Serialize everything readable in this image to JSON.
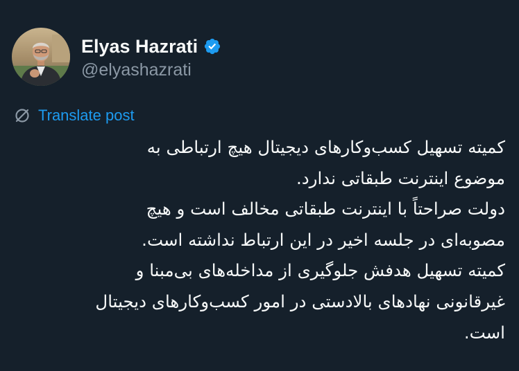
{
  "author": {
    "display_name": "Elyas Hazrati",
    "handle": "@elyashazrati",
    "verified": true
  },
  "icons": {
    "avatar": "profile-photo",
    "verified": "verified-badge-icon",
    "translate": "translate-icon"
  },
  "colors": {
    "background": "#15202b",
    "text": "#f7f9f9",
    "secondary": "#8b98a5",
    "accent": "#1d9bf0"
  },
  "translate": {
    "label": "Translate post"
  },
  "post": {
    "lines": [
      "کمیته تسهیل کسب‌وکارهای دیجیتال هیچ ارتباطی به",
      "موضوع اینترنت طبقاتی ندارد.",
      "دولت صراحتاً با اینترنت طبقاتی مخالف است و هیچ",
      "مصوبه‌ای در جلسه اخیر در این ارتباط نداشته است.",
      "کمیته تسهیل هدفش جلوگیری از مداخله‌های بی‌مبنا و",
      "غیرقانونی نهادهای بالادستی در امور کسب‌وکارهای دیجیتال",
      "است."
    ]
  }
}
